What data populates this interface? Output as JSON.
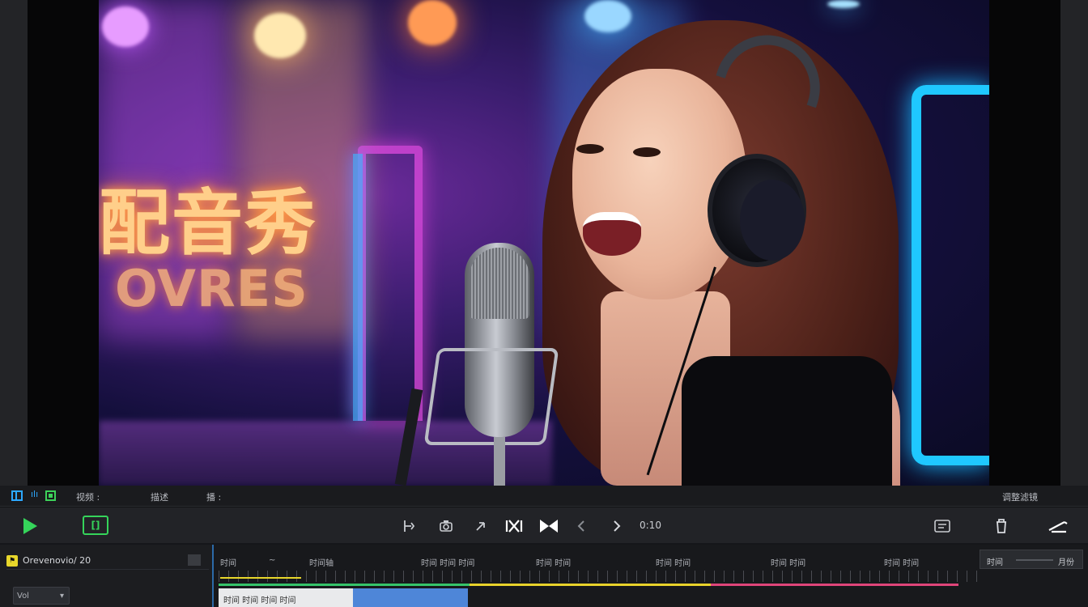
{
  "preview": {
    "neon_sign_text": "配音秀",
    "neon_sign_sub": "OVRES"
  },
  "infobar": {
    "left_label_1": "视频 :",
    "left_label_2": "描述",
    "left_label_3": "播 :",
    "right_label": "调整滤镜"
  },
  "transport": {
    "clip_button": "[]",
    "time_readout": "0:10"
  },
  "timeline": {
    "track_badge": "⚑",
    "track_name": "Orevenovio/ 20",
    "volume_label": "Vol",
    "ruler_labels": [
      "时间",
      "~",
      "时间轴",
      "时间 时间 时间",
      "时间 时间",
      "时间 时间",
      "时间 时间",
      "时间 时间"
    ],
    "clip_label": "时间 时间 时间 时间",
    "right_box_left": "时间",
    "right_box_right": "月份"
  },
  "colors": {
    "accent_green": "#35d45a",
    "accent_blue": "#2da8ff",
    "accent_yellow": "#e8d72b",
    "strip_green": "#36c46a",
    "strip_yellow": "#e8d22b",
    "strip_pink": "#e0457a"
  },
  "icons": [
    "grid-icon",
    "film-icon",
    "play-icon",
    "trim-icon",
    "camera-icon",
    "undo-icon",
    "split-icon",
    "bowtie-icon",
    "prev-frame-icon",
    "next-frame-icon",
    "export-icon",
    "trash-icon",
    "pen-icon"
  ]
}
